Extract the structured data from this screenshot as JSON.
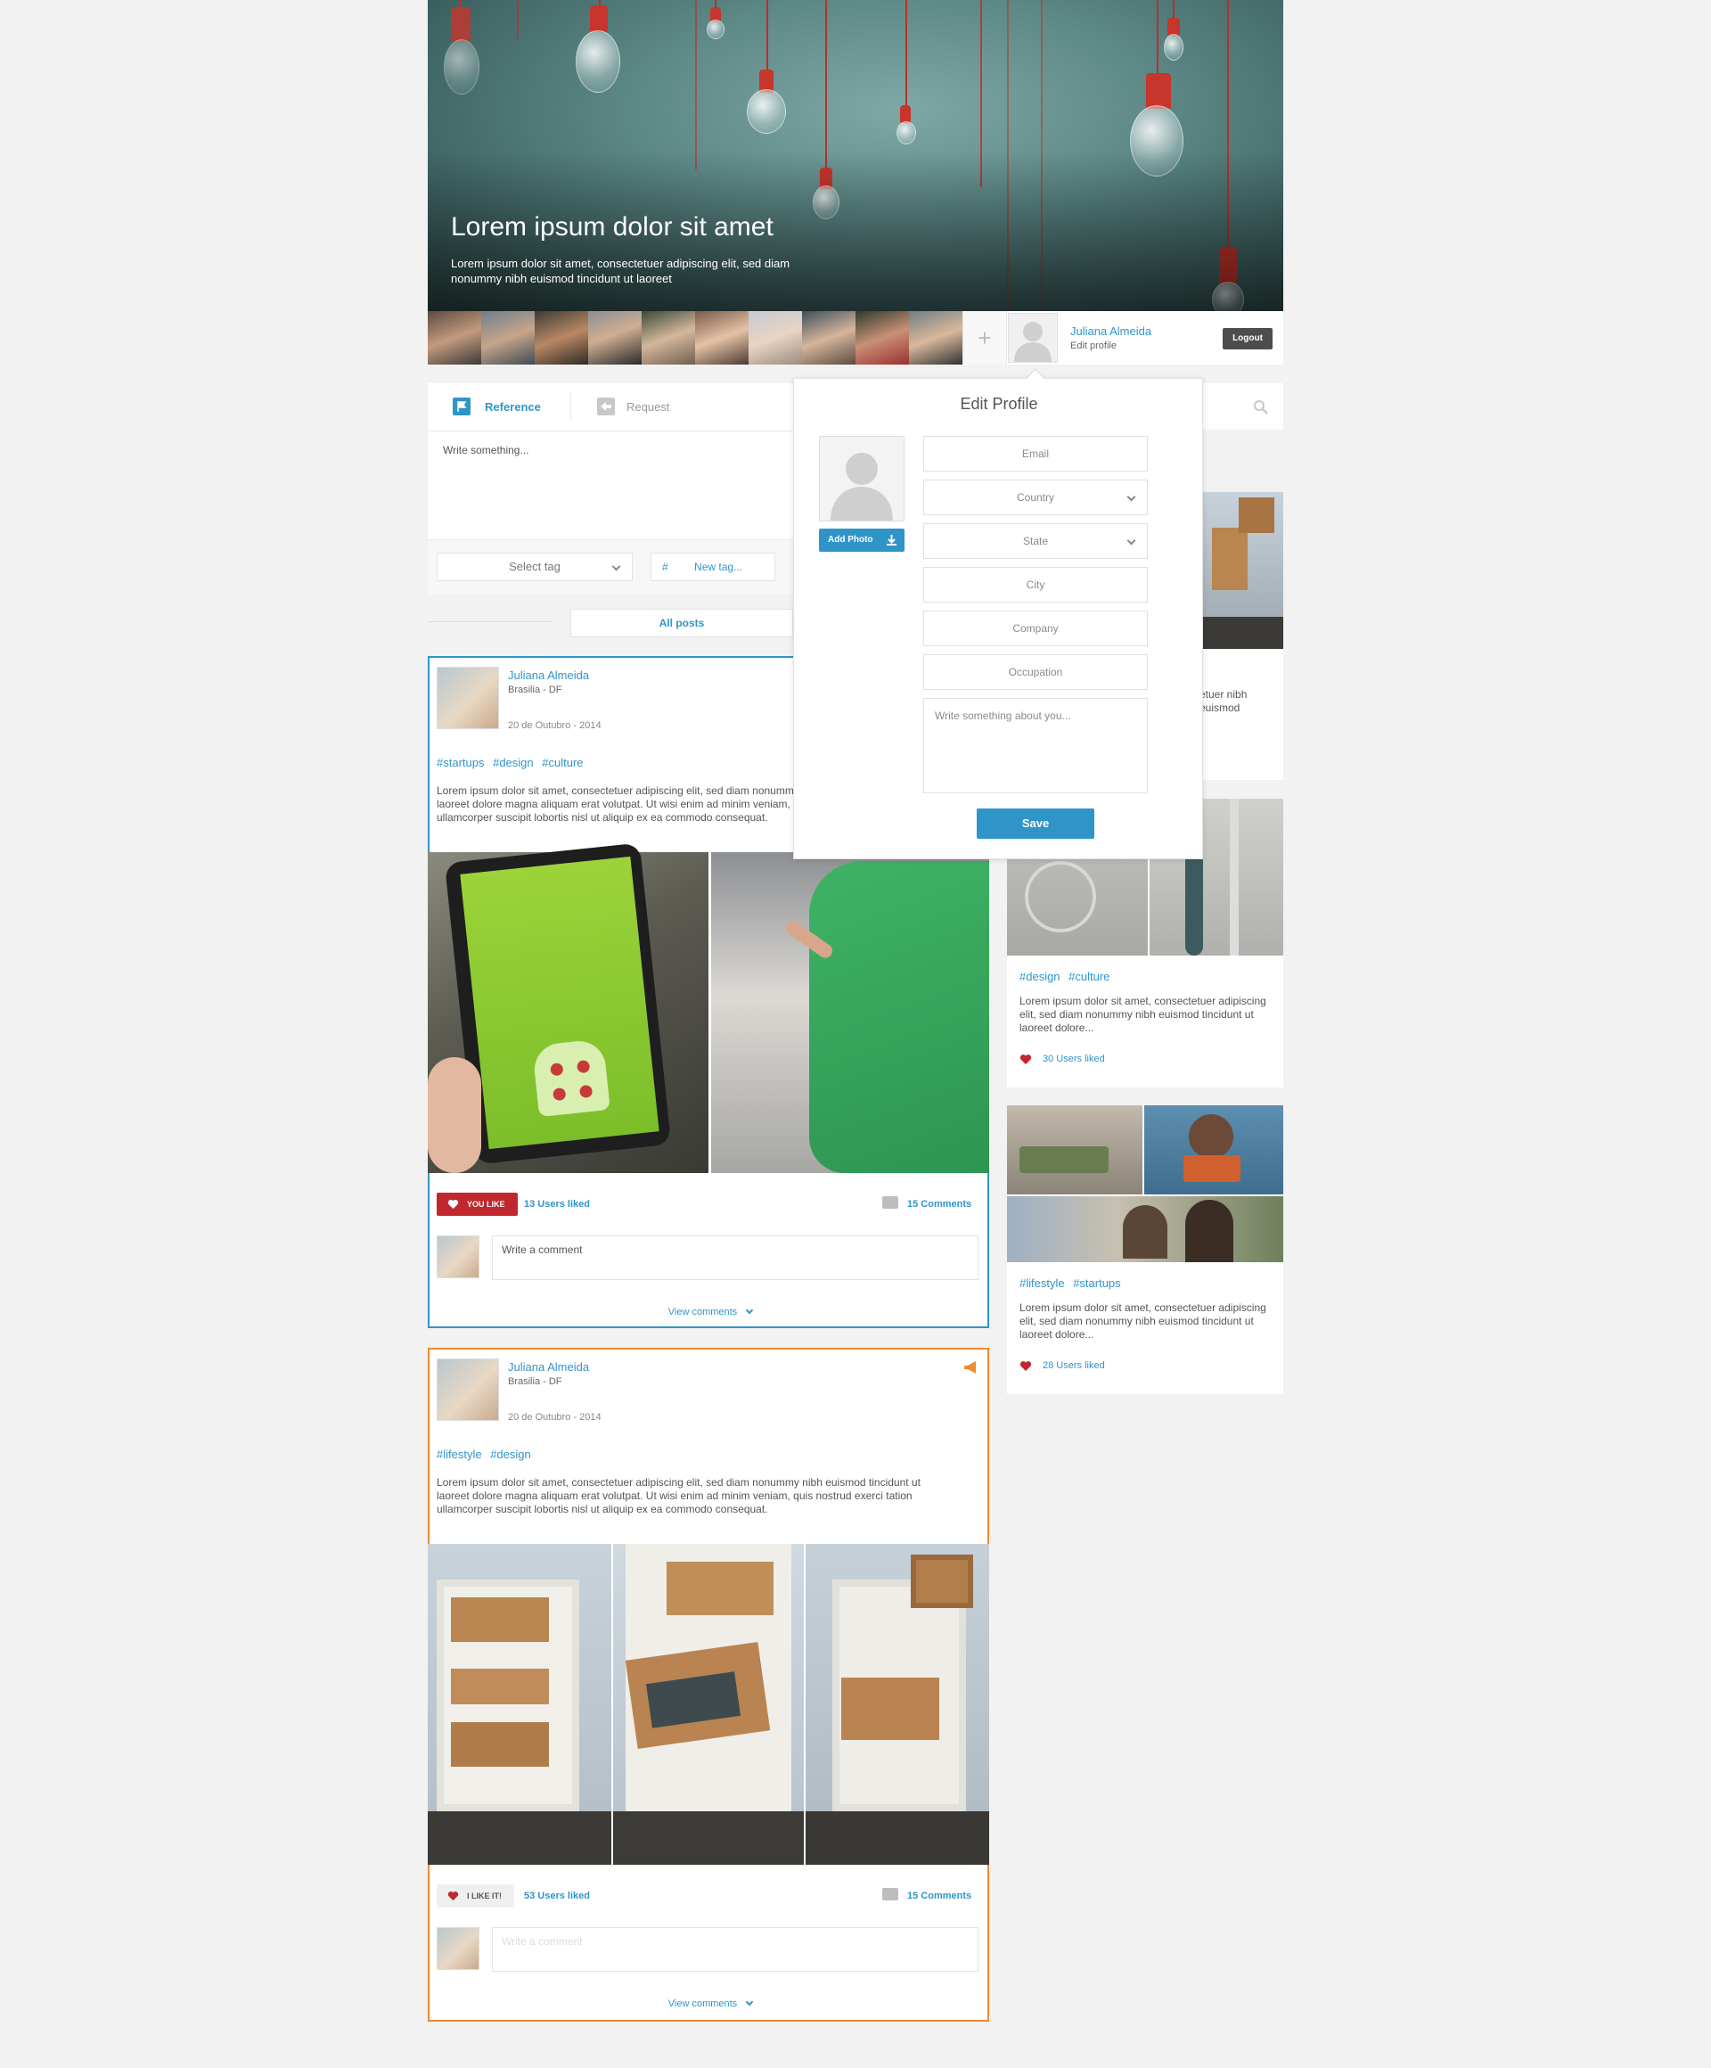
{
  "hero": {
    "title": "Lorem ipsum dolor sit amet",
    "subtitle": "Lorem ipsum dolor sit amet, consectetuer adipiscing elit, sed diam nonummy nibh euismod tincidunt ut laoreet"
  },
  "user": {
    "name": "Juliana Almeida",
    "edit_link": "Edit profile",
    "logout": "Logout"
  },
  "composer": {
    "tabs": [
      "Reference",
      "Request"
    ],
    "placeholder": "Write something...",
    "select_tag": "Select tag",
    "hash": "#",
    "new_tag": "New tag..."
  },
  "filter": {
    "all_posts": "All posts"
  },
  "posts": [
    {
      "author": "Juliana Almeida",
      "location": "Brasilia - DF",
      "date": "20 de Outubro - 2014",
      "tags": "#startups #design #culture",
      "body": "Lorem ipsum dolor sit amet, consectetuer adipiscing elit, sed diam nonummy nibh euismod tincidunt ut laoreet dolore magna aliquam erat volutpat. Ut wisi enim ad minim veniam, quis nostrud exerci tation ullamcorper suscipit lobortis nisl ut aliquip ex ea commodo consequat.",
      "like_label": "YOU LIKE",
      "likes": "13 Users liked",
      "comments": "15 Comments",
      "comment_placeholder": "Write a comment",
      "view_comments": "View comments"
    },
    {
      "author": "Juliana Almeida",
      "location": "Brasilia - DF",
      "date": "20 de Outubro - 2014",
      "tags": "#lifestyle #design",
      "body": "Lorem ipsum dolor sit amet, consectetuer adipiscing elit, sed diam nonummy nibh euismod tincidunt ut laoreet dolore magna aliquam erat volutpat. Ut wisi enim ad minim veniam, quis nostrud exerci tation ullamcorper suscipit lobortis nisl ut aliquip ex ea commodo consequat.",
      "like_label": "I LIKE IT!",
      "likes": "53 Users liked",
      "comments": "15 Comments",
      "comment_placeholder": "Write a comment",
      "view_comments": "View comments"
    }
  ],
  "side_cards": [
    {
      "body_partial": "etuer nibh euismod"
    },
    {
      "tags": "#design #culture",
      "body": "Lorem ipsum dolor sit amet, consectetuer adipiscing elit, sed diam nonummy nibh euismod tincidunt ut laoreet dolore...",
      "likes": "30 Users liked"
    },
    {
      "tags": "#lifestyle #startups",
      "body": "Lorem ipsum dolor sit amet, consectetuer adipiscing elit, sed diam nonummy nibh euismod tincidunt ut laoreet dolore...",
      "likes": "28 Users liked"
    }
  ],
  "modal": {
    "title": "Edit Profile",
    "add_photo": "Add Photo",
    "fields": [
      "Email",
      "Country",
      "State",
      "City",
      "Company",
      "Occupation"
    ],
    "about_placeholder": "Write something about you...",
    "save": "Save"
  },
  "colors": {
    "accent": "#2f95c9",
    "orange": "#ef8a2e",
    "like_red": "#c0282d"
  },
  "icons": [
    "flag-icon",
    "request-icon",
    "search-icon",
    "plus-icon",
    "heart-icon",
    "comment-icon",
    "chevron-down-icon",
    "download-icon",
    "megaphone-icon"
  ]
}
